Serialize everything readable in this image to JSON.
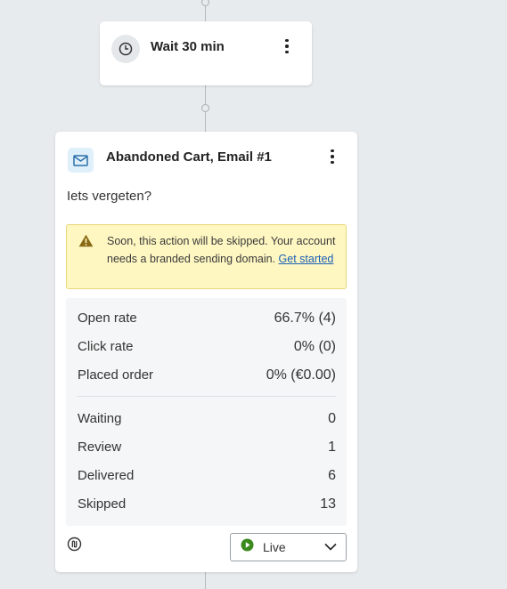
{
  "wait_step": {
    "title": "Wait 30 min",
    "icon": "clock-icon"
  },
  "email_step": {
    "title": "Abandoned Cart, Email #1",
    "icon": "envelope-icon",
    "subject": "Iets vergeten?",
    "warning": {
      "text": "Soon, this action will be skipped. Your account needs a branded sending domain.",
      "link": "Get started"
    },
    "stats": {
      "performance": [
        {
          "label": "Open rate",
          "value": "66.7% (4)"
        },
        {
          "label": "Click rate",
          "value": "0% (0)"
        },
        {
          "label": "Placed order",
          "value": "0% (€0.00)"
        }
      ],
      "status_counts": [
        {
          "label": "Waiting",
          "value": "0"
        },
        {
          "label": "Review",
          "value": "1"
        },
        {
          "label": "Delivered",
          "value": "6"
        },
        {
          "label": "Skipped",
          "value": "13"
        }
      ]
    },
    "status": {
      "selected": "Live",
      "color": "#3b8a1e"
    }
  },
  "colors": {
    "canvas": "#e8ebee",
    "warning_bg": "#fff7c2",
    "link": "#1a5fb4"
  }
}
